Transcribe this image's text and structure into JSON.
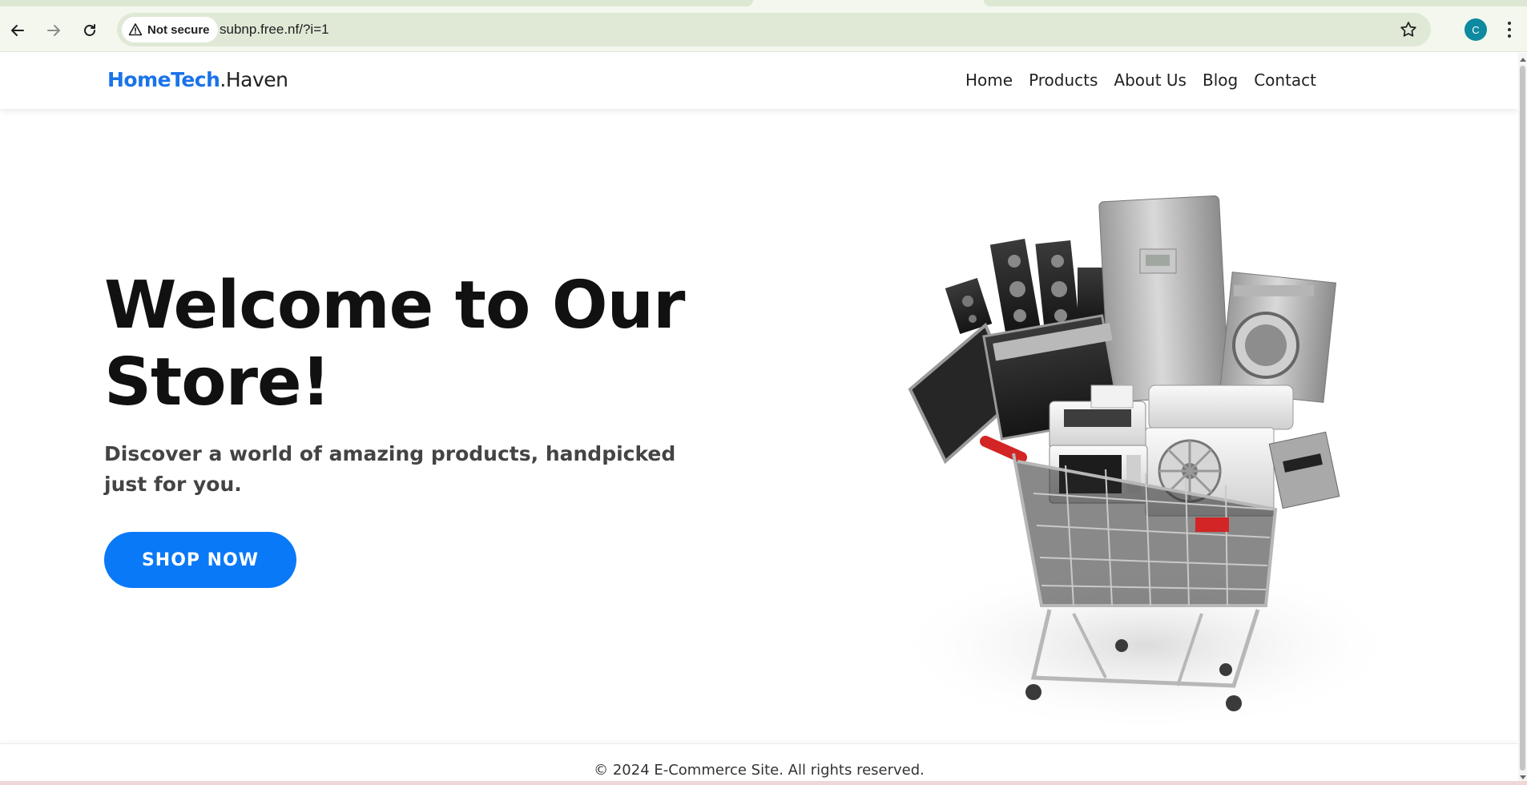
{
  "browser": {
    "security_label": "Not secure",
    "url": "subnp.free.nf/?i=1",
    "profile_initial": "C",
    "icons": [
      "back-arrow-icon",
      "forward-arrow-icon",
      "reload-icon",
      "warning-triangle-icon",
      "star-icon",
      "kebab-menu-icon"
    ]
  },
  "header": {
    "brand_primary": "HomeTech",
    "brand_secondary": ".Haven",
    "nav": [
      "Home",
      "Products",
      "About Us",
      "Blog",
      "Contact"
    ]
  },
  "hero": {
    "title_line1": "Welcome to Our",
    "title_line2": "Store!",
    "subtitle": "Discover a world of amazing products, handpicked just for you.",
    "cta_label": "SHOP NOW",
    "image_subject": "shopping cart filled with home appliances"
  },
  "footer": {
    "copyright": "© 2024 E-Commerce Site. All rights reserved."
  },
  "colors": {
    "brand_blue": "#1a73e8",
    "cta_blue": "#0a79f7",
    "title_text": "#111111",
    "subtitle_text": "#444444",
    "chrome_bg": "#f3f7ee",
    "omnibox_bg": "#dfe9d6",
    "avatar_bg": "#0d8aa0"
  }
}
